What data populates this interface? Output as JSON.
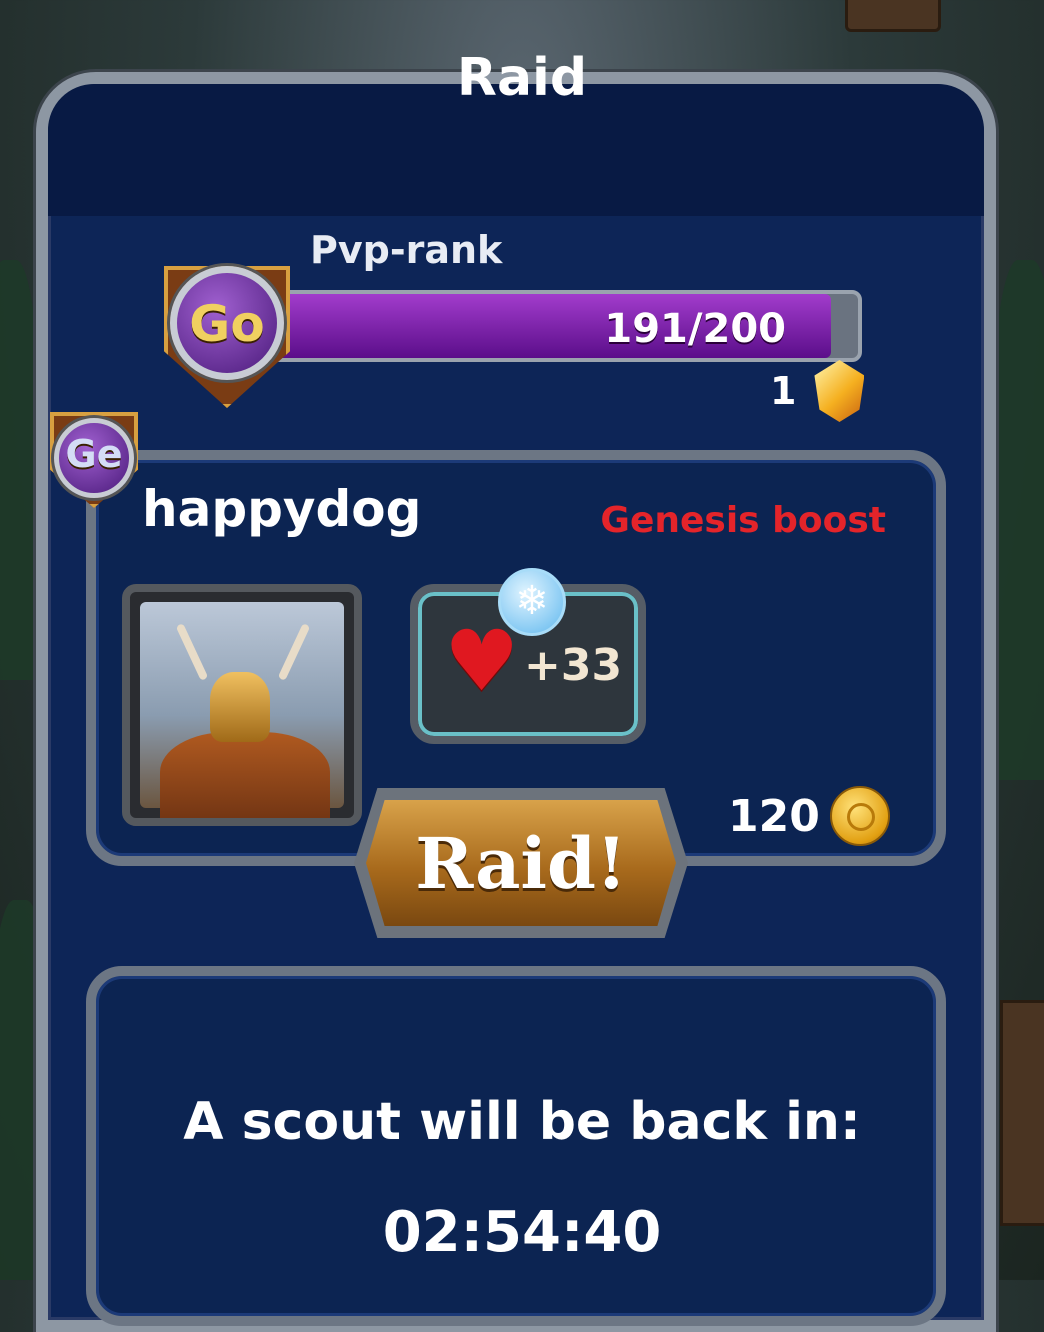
{
  "window": {
    "title": "Raid"
  },
  "rank": {
    "label": "Pvp-rank",
    "badge_code": "Go",
    "progress_text": "191/200",
    "progress_current": 191,
    "progress_max": 200,
    "reward_count": "1",
    "reward_icon": "gem-icon"
  },
  "opponent": {
    "badge_code": "Ge",
    "name": "happydog",
    "boost_label": "Genesis boost",
    "portrait_icon": "warrior-portrait",
    "bonus": {
      "icon": "heart-icon",
      "badge_icon": "snowflake-icon",
      "value": "+33"
    },
    "cost": {
      "value": "120",
      "icon": "coin-icon"
    },
    "action_label": "Raid!"
  },
  "scout": {
    "message": "A scout will be back in:",
    "timer": "02:54:40"
  },
  "colors": {
    "panel": "#0d2557",
    "progress_fill": "#8a28b8",
    "boost_text": "#e4242a",
    "button_gold": "#c48a34"
  }
}
